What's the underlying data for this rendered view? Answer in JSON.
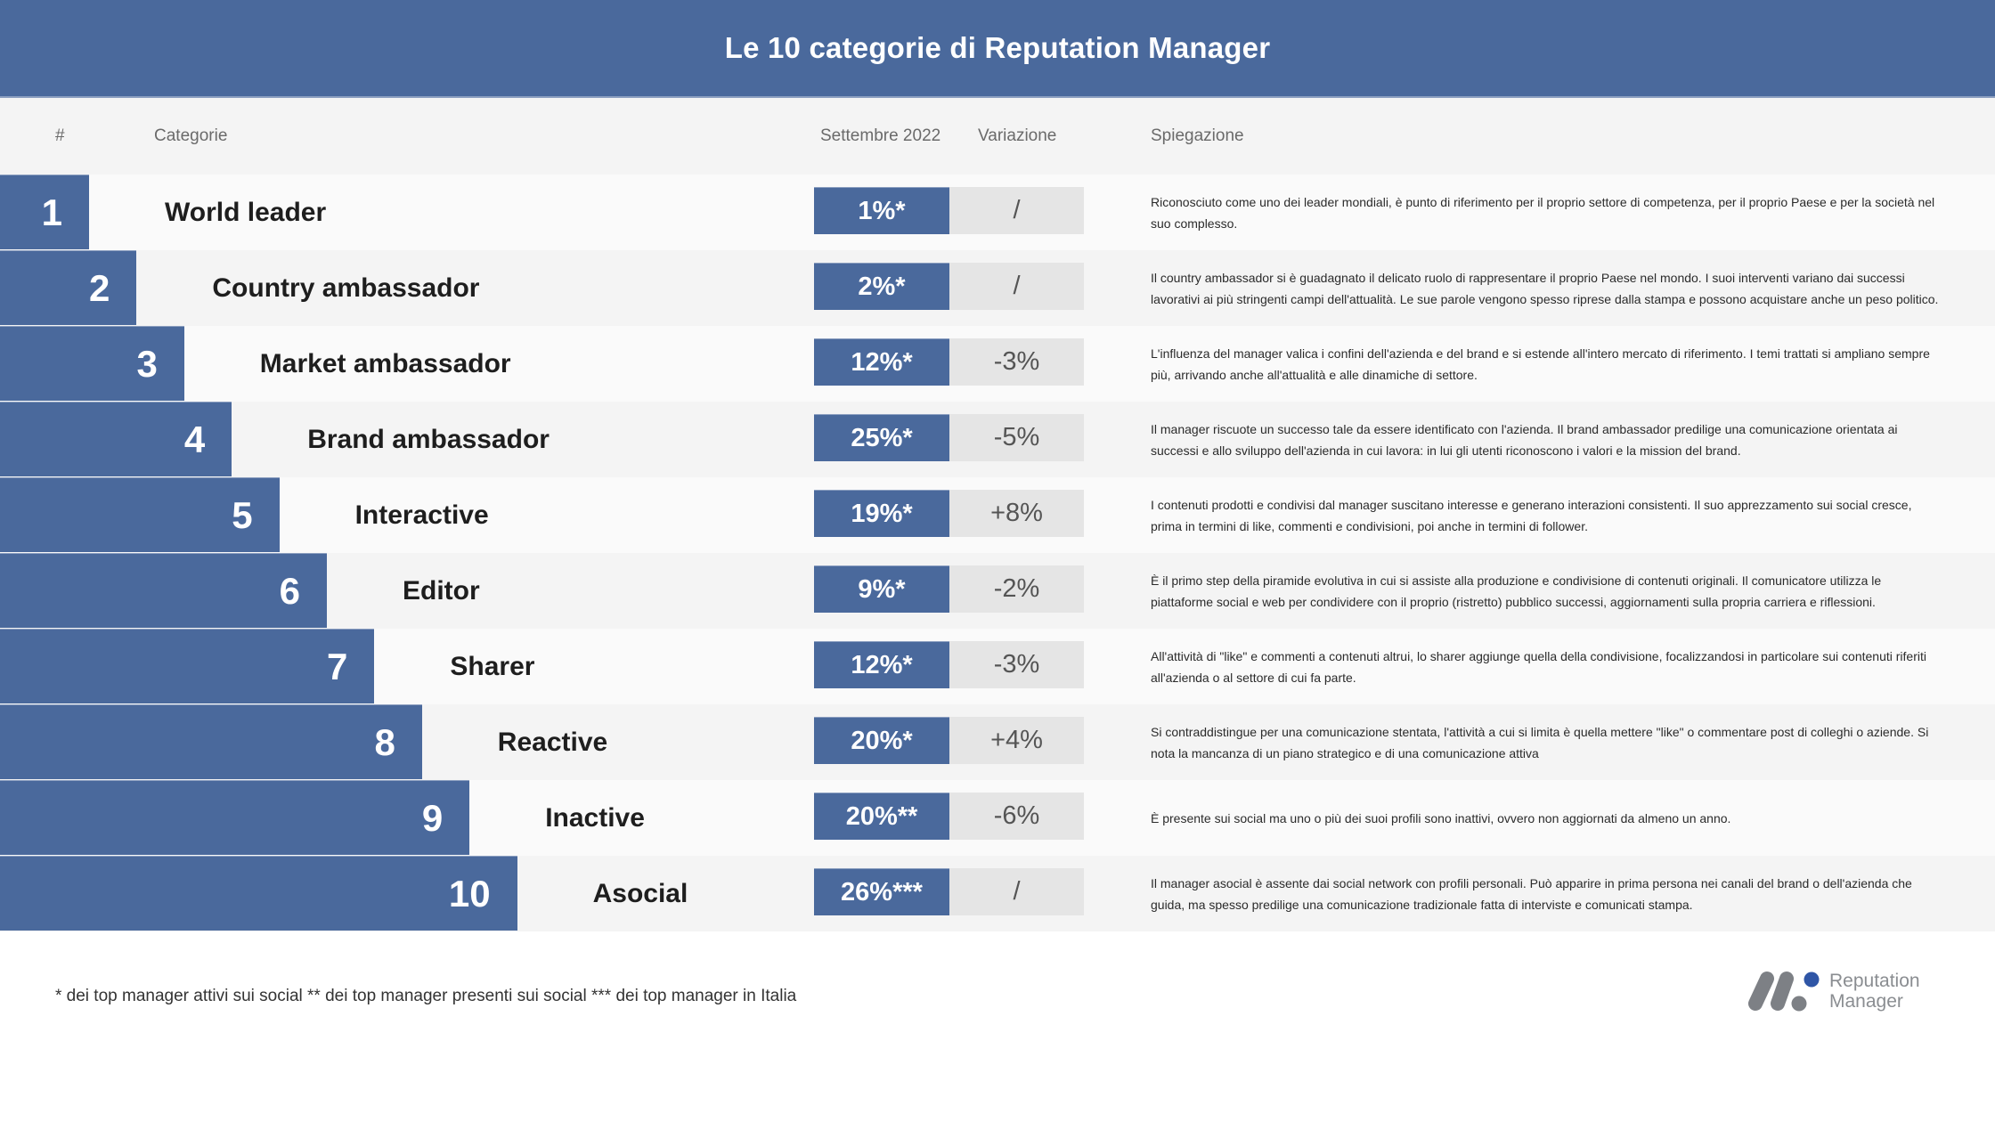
{
  "title": "Le 10 categorie di Reputation Manager",
  "columns": {
    "number": "#",
    "category": "Categorie",
    "september": "Settembre 2022",
    "variation": "Variazione",
    "explanation": "Spiegazione"
  },
  "colors": {
    "brand_blue": "#4A699C",
    "variation_grey": "#E5E5E5",
    "row_light": "#FAFAFA",
    "row_dark": "#F4F4F4",
    "logo_dot_blue": "#2F56A6",
    "logo_grey": "#7D8085"
  },
  "rows": [
    {
      "rank": "1",
      "category": "World leader",
      "value": "1%*",
      "variation": "/",
      "explanation": "Riconosciuto come uno dei leader mondiali, è punto di riferimento per il proprio settore di competenza, per il proprio Paese e per la società nel suo complesso."
    },
    {
      "rank": "2",
      "category": "Country ambassador",
      "value": "2%*",
      "variation": "/",
      "explanation": "Il country ambassador si è guadagnato il delicato ruolo di rappresentare il proprio Paese nel mondo. I suoi interventi variano dai successi lavorativi ai più stringenti campi dell'attualità. Le sue parole vengono spesso riprese dalla stampa e possono acquistare anche un peso politico."
    },
    {
      "rank": "3",
      "category": "Market ambassador",
      "value": "12%*",
      "variation": "-3%",
      "explanation": "L'influenza del manager valica i confini dell'azienda e del brand e si estende all'intero mercato di riferimento. I temi trattati si ampliano sempre più, arrivando anche all'attualità e alle dinamiche di settore."
    },
    {
      "rank": "4",
      "category": "Brand ambassador",
      "value": "25%*",
      "variation": "-5%",
      "explanation": "Il manager riscuote un successo tale da essere identificato con l'azienda. Il brand ambassador predilige una comunicazione orientata ai successi e allo sviluppo dell'azienda in cui lavora: in lui gli utenti riconoscono i valori e la mission del brand."
    },
    {
      "rank": "5",
      "category": "Interactive",
      "value": "19%*",
      "variation": "+8%",
      "explanation": "I contenuti prodotti e condivisi dal manager suscitano interesse e generano interazioni consistenti. Il suo apprezzamento sui social cresce, prima in termini di like, commenti e condivisioni, poi anche in termini di follower."
    },
    {
      "rank": "6",
      "category": "Editor",
      "value": "9%*",
      "variation": "-2%",
      "explanation": "È il primo step della piramide evolutiva in cui si assiste alla produzione e condivisione di contenuti originali. Il comunicatore utilizza le piattaforme social e web per condividere con il proprio (ristretto) pubblico successi, aggiornamenti sulla propria carriera e riflessioni."
    },
    {
      "rank": "7",
      "category": "Sharer",
      "value": "12%*",
      "variation": "-3%",
      "explanation": "All'attività di \"like\" e commenti a contenuti altrui, lo sharer aggiunge quella della condivisione, focalizzandosi in particolare sui contenuti riferiti all'azienda o al settore di cui fa parte."
    },
    {
      "rank": "8",
      "category": "Reactive",
      "value": "20%*",
      "variation": "+4%",
      "explanation": "Si contraddistingue per una comunicazione stentata, l'attività a cui si limita è quella mettere \"like\" o commentare post di colleghi o aziende. Si nota la mancanza di un piano strategico e di una comunicazione attiva"
    },
    {
      "rank": "9",
      "category": "Inactive",
      "value": "20%**",
      "variation": "-6%",
      "explanation": "È presente sui social ma uno o più dei suoi profili sono inattivi, ovvero non aggiornati da almeno un anno."
    },
    {
      "rank": "10",
      "category": "Asocial",
      "value": "26%***",
      "variation": "/",
      "explanation": "Il manager asocial è assente dai social network con profili personali. Può apparire in prima persona nei canali del brand o dell'azienda che guida, ma spesso predilige una comunicazione tradizionale fatta di interviste e comunicati stampa."
    }
  ],
  "footnote": "* dei top manager attivi sui social ** dei top manager presenti sui social *** dei top manager in Italia",
  "logo": {
    "icon": "reputation-manager-logo-icon",
    "line1": "Reputation",
    "line2": "Manager"
  }
}
